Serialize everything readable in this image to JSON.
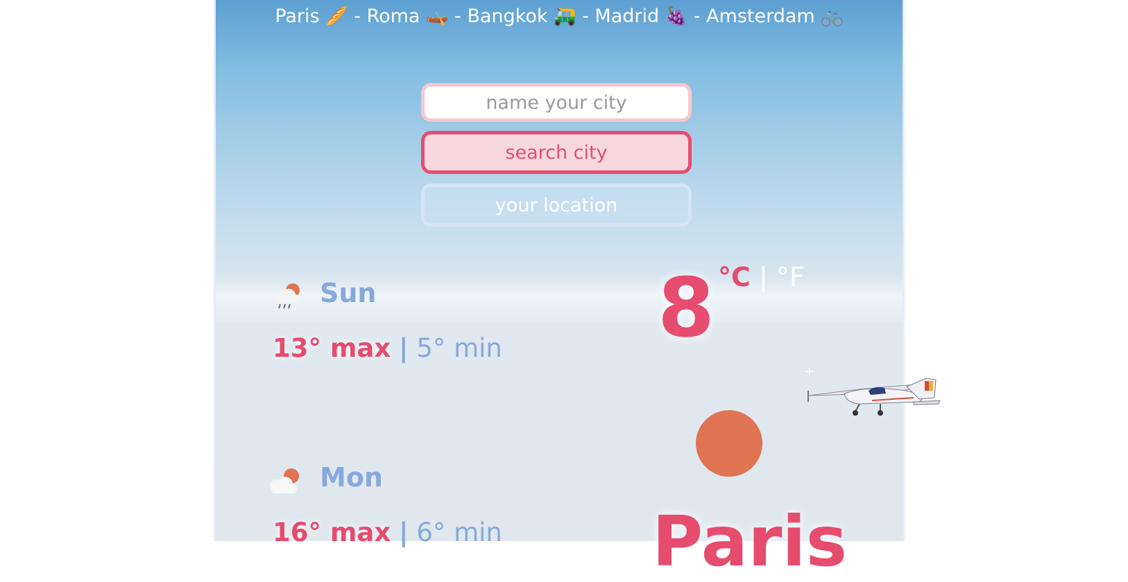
{
  "header": {
    "cities": [
      {
        "name": "Paris",
        "emoji": "🥖"
      },
      {
        "name": "Roma",
        "emoji": "🛶"
      },
      {
        "name": "Bangkok",
        "emoji": "🛺"
      },
      {
        "name": "Madrid",
        "emoji": "🍇"
      },
      {
        "name": "Amsterdam",
        "emoji": "🚲"
      }
    ],
    "separator": "-"
  },
  "search": {
    "placeholder": "name your city",
    "value": "",
    "search_button_label": "search city",
    "location_button_label": "your location"
  },
  "current": {
    "temperature": "8",
    "unit_celsius": "°C",
    "unit_separator": "|",
    "unit_fahrenheit": "°F",
    "city": "Paris",
    "weather_icon": "sun-icon"
  },
  "forecast": [
    {
      "day": "Sun",
      "max": "13° max",
      "separator": "|",
      "min": "5° min",
      "icon": "rain-cloud-sun-icon"
    },
    {
      "day": "Mon",
      "max": "16° max",
      "separator": "|",
      "min": "6° min",
      "icon": "cloud-sun-icon"
    }
  ],
  "colors": {
    "accent": "#e64c6e",
    "secondary": "#86a8dc",
    "sun": "#e07453",
    "sky_top": "#5d9fd3"
  }
}
